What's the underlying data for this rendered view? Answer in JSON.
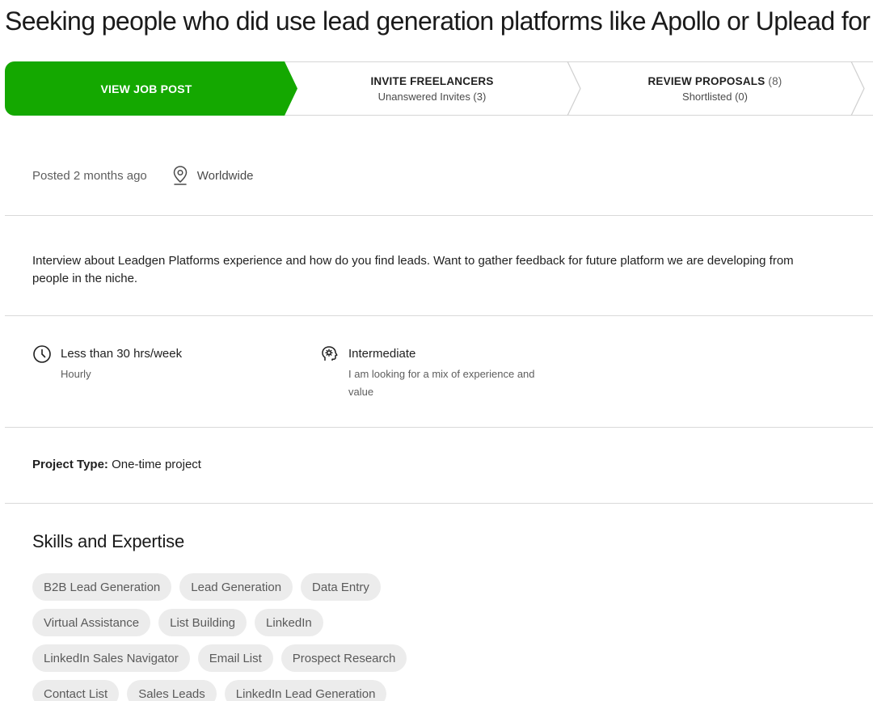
{
  "job": {
    "title": "Seeking people who did use lead generation platforms like Apollo or Uplead for a"
  },
  "stepper": {
    "view_job_post": "VIEW JOB POST",
    "invite_freelancers": {
      "title": "INVITE FREELANCERS",
      "sub": "Unanswered Invites (3)"
    },
    "review_proposals": {
      "title": "REVIEW PROPOSALS",
      "count": "(8)",
      "sub": "Shortlisted (0)"
    }
  },
  "meta": {
    "posted": "Posted 2 months ago",
    "location": "Worldwide",
    "location_icon": "map-pin-icon"
  },
  "description": "Interview about Leadgen Platforms experience and how do you find leads. Want to gather feedback for future platform we are developing from people in the niche.",
  "features": {
    "hours": {
      "icon": "clock-icon",
      "title": "Less than 30 hrs/week",
      "sub": "Hourly"
    },
    "level": {
      "icon": "brain-gear-icon",
      "title": "Intermediate",
      "sub": "I am looking for a mix of experience and value"
    }
  },
  "project_type": {
    "label": "Project Type:",
    "value": "One-time project"
  },
  "skills": {
    "heading": "Skills and Expertise",
    "rows": [
      [
        "B2B Lead Generation",
        "Lead Generation",
        "Data Entry"
      ],
      [
        "Virtual Assistance",
        "List Building",
        "LinkedIn"
      ],
      [
        "LinkedIn Sales Navigator",
        "Email List",
        "Prospect Research"
      ],
      [
        "Contact List",
        "Sales Leads",
        "LinkedIn Lead Generation"
      ]
    ]
  },
  "colors": {
    "accent_green": "#14a800",
    "chip_bg": "#ececec",
    "divider": "#d9d9d9"
  }
}
